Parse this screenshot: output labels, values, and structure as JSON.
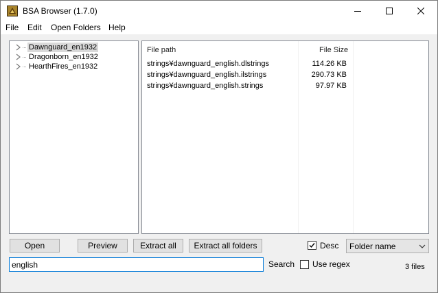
{
  "window": {
    "title": "BSA Browser (1.7.0)",
    "icon": "bsa-browser-app-icon",
    "controls": [
      "minimize-icon",
      "maximize-icon",
      "close-icon"
    ]
  },
  "menu": {
    "items": [
      {
        "label": "File"
      },
      {
        "label": "Edit"
      },
      {
        "label": "Open Folders"
      },
      {
        "label": "Help"
      }
    ]
  },
  "tree": {
    "nodes": [
      {
        "label": "Dawnguard_en1932",
        "selected": true
      },
      {
        "label": "Dragonborn_en1932",
        "selected": false
      },
      {
        "label": "HearthFires_en1932",
        "selected": false
      }
    ]
  },
  "file_list": {
    "columns": [
      "File path",
      "File Size"
    ],
    "rows": [
      {
        "path": "strings¥dawnguard_english.dlstrings",
        "size": "114.26 KB"
      },
      {
        "path": "strings¥dawnguard_english.ilstrings",
        "size": "290.73 KB"
      },
      {
        "path": "strings¥dawnguard_english.strings",
        "size": "97.97 KB"
      }
    ]
  },
  "buttons": {
    "open": "Open",
    "preview": "Preview",
    "extract_all": "Extract all",
    "extract_all_folders": "Extract all folders"
  },
  "sort": {
    "desc_label": "Desc",
    "desc_checked": true,
    "selected": "Folder name"
  },
  "search": {
    "value": "english",
    "label": "Search",
    "regex_label": "Use regex",
    "regex_checked": false
  },
  "status": {
    "count": "3 files"
  }
}
